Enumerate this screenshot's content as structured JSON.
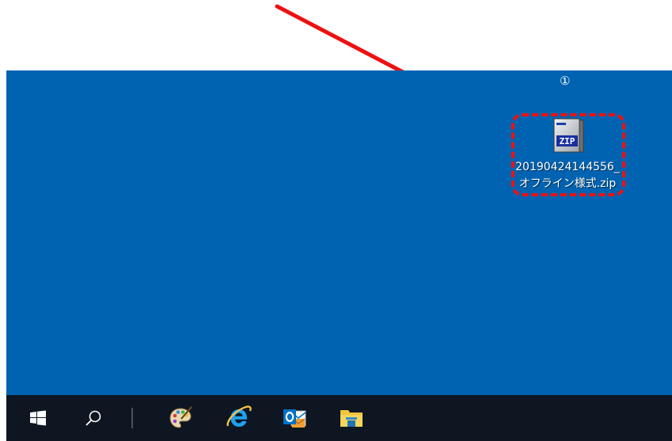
{
  "annotation": {
    "step_marker": "①",
    "arrow_color": "#ee1111",
    "highlight_color": "#ee1111"
  },
  "desktop": {
    "background": "#0063b1",
    "icons": [
      {
        "icon": "zip-file-icon",
        "label_line1": "20190424144556_",
        "label_line2": "オフライン様式.zip"
      }
    ]
  },
  "taskbar": {
    "background": "#0d1621",
    "items": [
      {
        "icon": "windows-start-icon"
      },
      {
        "icon": "search-icon"
      },
      {
        "icon": "paint-palette-icon"
      },
      {
        "icon": "internet-explorer-icon"
      },
      {
        "icon": "outlook-icon"
      },
      {
        "icon": "file-explorer-icon"
      }
    ]
  }
}
